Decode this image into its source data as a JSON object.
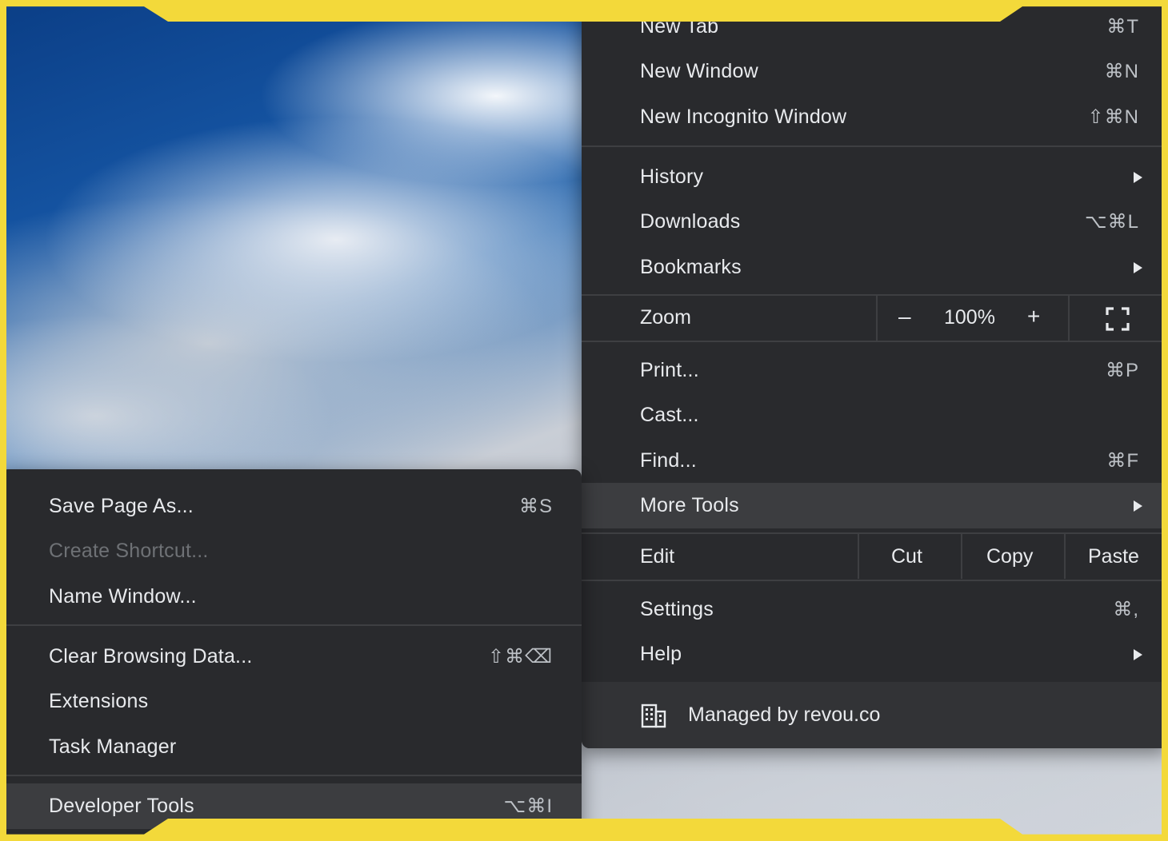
{
  "main_menu": {
    "top_items": [
      {
        "label": "New Tab",
        "shortcut": "⌘T"
      },
      {
        "label": "New Window",
        "shortcut": "⌘N"
      },
      {
        "label": "New Incognito Window",
        "shortcut": "⇧⌘N"
      }
    ],
    "nav_items": [
      {
        "label": "History",
        "has_submenu": true
      },
      {
        "label": "Downloads",
        "shortcut": "⌥⌘L"
      },
      {
        "label": "Bookmarks",
        "has_submenu": true
      }
    ],
    "zoom": {
      "label": "Zoom",
      "minus": "–",
      "value": "100%",
      "plus": "+",
      "fullscreen_icon": "fullscreen-icon"
    },
    "tool_items": [
      {
        "label": "Print...",
        "shortcut": "⌘P"
      },
      {
        "label": "Cast..."
      },
      {
        "label": "Find...",
        "shortcut": "⌘F"
      },
      {
        "label": "More Tools",
        "has_submenu": true,
        "highlighted": true
      }
    ],
    "edit": {
      "label": "Edit",
      "cut": "Cut",
      "copy": "Copy",
      "paste": "Paste"
    },
    "settings_items": [
      {
        "label": "Settings",
        "shortcut": "⌘,"
      },
      {
        "label": "Help",
        "has_submenu": true
      }
    ],
    "managed": {
      "label": "Managed by revou.co",
      "icon": "building-icon"
    }
  },
  "sub_menu": {
    "items": [
      {
        "label": "Save Page As...",
        "shortcut": "⌘S"
      },
      {
        "label": "Create Shortcut...",
        "disabled": true
      },
      {
        "label": "Name Window..."
      },
      {
        "label": "Clear Browsing Data...",
        "shortcut": "⇧⌘⌫"
      },
      {
        "label": "Extensions"
      },
      {
        "label": "Task Manager"
      },
      {
        "label": "Developer Tools",
        "shortcut": "⌥⌘I",
        "highlighted": true
      }
    ]
  },
  "colors": {
    "menu_bg": "#292a2d",
    "highlight": "#3c3d40",
    "frame": "#f3d93a",
    "text": "#e8eaed"
  }
}
